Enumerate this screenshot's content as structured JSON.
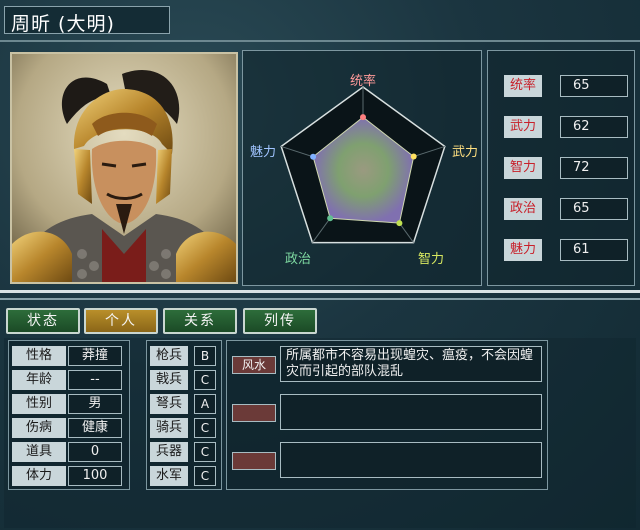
{
  "officer": {
    "name": "周昕 (大明)"
  },
  "radar": {
    "labels": {
      "top": "统率",
      "right_top": "武力",
      "right_bottom": "智力",
      "left_bottom": "政治",
      "left_top": "魅力"
    },
    "values": {
      "command": 65,
      "war": 62,
      "intelligence": 72,
      "politics": 65,
      "charisma": 61
    },
    "max": 100,
    "colors": {
      "command": "#ff8080",
      "war": "#ffe060",
      "intelligence": "#c0e050",
      "politics": "#60c090",
      "charisma": "#80b0ff"
    }
  },
  "stats": [
    {
      "label": "统率",
      "value": "65"
    },
    {
      "label": "武力",
      "value": "62"
    },
    {
      "label": "智力",
      "value": "72"
    },
    {
      "label": "政治",
      "value": "65"
    },
    {
      "label": "魅力",
      "value": "61"
    }
  ],
  "tabs": [
    {
      "label": "状态",
      "active": false
    },
    {
      "label": "个人",
      "active": true
    },
    {
      "label": "关系",
      "active": false
    },
    {
      "label": "列传",
      "active": false
    }
  ],
  "personal": [
    {
      "label": "性格",
      "value": "莽撞"
    },
    {
      "label": "年龄",
      "value": "--"
    },
    {
      "label": "性别",
      "value": "男"
    },
    {
      "label": "伤病",
      "value": "健康"
    },
    {
      "label": "道具",
      "value": "0"
    },
    {
      "label": "体力",
      "value": "100"
    }
  ],
  "units": [
    {
      "label": "枪兵",
      "value": "B"
    },
    {
      "label": "戟兵",
      "value": "C"
    },
    {
      "label": "弩兵",
      "value": "A"
    },
    {
      "label": "骑兵",
      "value": "C"
    },
    {
      "label": "兵器",
      "value": "C"
    },
    {
      "label": "水军",
      "value": "C"
    }
  ],
  "skills": [
    {
      "name": "风水",
      "desc": "所属都市不容易出现蝗灾、瘟疫，不会因蝗灾而引起的部队混乱"
    },
    {
      "name": "",
      "desc": ""
    },
    {
      "name": "",
      "desc": ""
    }
  ]
}
